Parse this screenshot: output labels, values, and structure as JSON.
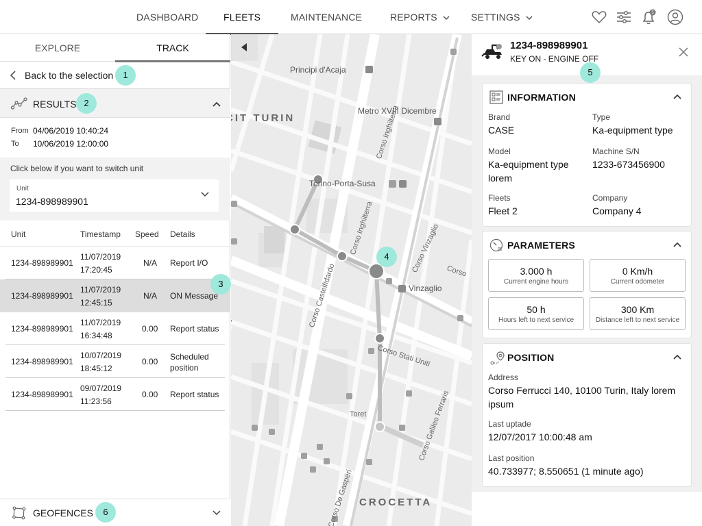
{
  "nav": {
    "items": [
      {
        "label": "DASHBOARD"
      },
      {
        "label": "FLEETS"
      },
      {
        "label": "MAINTENANCE"
      },
      {
        "label": "REPORTS"
      },
      {
        "label": "SETTINGS"
      }
    ],
    "notification_count": "5",
    "icons": [
      "heart-icon",
      "sliders-icon",
      "bell-icon",
      "user-icon"
    ]
  },
  "left": {
    "tabs": [
      {
        "label": "EXPLORE"
      },
      {
        "label": "TRACK"
      }
    ],
    "back_label": "Back to the selection",
    "results_label": "RESULTS",
    "from_label": "From",
    "from_value": "04/06/2019 10:40:24",
    "to_label": "To",
    "to_value": "10/06/2019 12:00:00",
    "switch_hint": "Click below if you want to switch unit",
    "unit_field_label": "Unit",
    "unit_field_value": "1234-898989901",
    "columns": [
      "Unit",
      "Timestamp",
      "Speed",
      "Details"
    ],
    "rows": [
      {
        "unit": "1234-898989901",
        "date": "11/07/2019",
        "time": "17:20:45",
        "speed": "N/A",
        "details": "Report I/O"
      },
      {
        "unit": "1234-898989901",
        "date": "11/07/2019",
        "time": "12:45:15",
        "speed": "N/A",
        "details": "ON Message"
      },
      {
        "unit": "1234-898989901",
        "date": "11/07/2019",
        "time": "16:34:48",
        "speed": "0.00",
        "details": "Report status"
      },
      {
        "unit": "1234-898989901",
        "date": "10/07/2019",
        "time": "18:45:12",
        "speed": "0.00",
        "details_1": "Scheduled",
        "details_2": "position"
      },
      {
        "unit": "1234-898989901",
        "date": "09/07/2019",
        "time": "11:23:56",
        "speed": "0.00",
        "details": "Report status"
      }
    ],
    "geofences_label": "GEOFENCES"
  },
  "badges": [
    "1",
    "2",
    "3",
    "4",
    "5",
    "6"
  ],
  "map": {
    "labels": {
      "principi": "Principi d'Acaja",
      "cit_turin": "CIT TURIN",
      "metro": "Metro XVIII Dicembre",
      "porta_susa": "Torino-Porta-Susa",
      "corso_inghilterra_1": "Corso Inghilterra",
      "corso_inghilterra_2": "Corso Inghilterra",
      "corso_vinzaglio": "Corso Vinzaglio",
      "corso_castelfidardo": "Corso Castelfidardo",
      "vinzaglio": "Vinzaglio",
      "corso_stati_uniti": "Corso Stati Uniti",
      "corso_galileo": "Corso Galileo Ferraris",
      "toret": "Toret",
      "crocetta": "CROCETTA",
      "de_gasperi": "Corso De Gasperi",
      "corso_co": "Corso"
    }
  },
  "right": {
    "title": "1234-898989901",
    "subtitle": "KEY ON - ENGINE OFF",
    "information": {
      "header": "INFORMATION",
      "brand_label": "Brand",
      "brand_value": "CASE",
      "type_label": "Type",
      "type_value": "Ka-equipment type",
      "model_label": "Model",
      "model_value_1": "Ka-equipment type",
      "model_value_2": "lorem",
      "sn_label": "Machine S/N",
      "sn_value": "1233-673456900",
      "fleets_label": "Fleets",
      "fleets_value": "Fleet 2",
      "company_label": "Company",
      "company_value": "Company 4"
    },
    "parameters": {
      "header": "PARAMETERS",
      "boxes": [
        {
          "value": "3.000 h",
          "label": "Current engine hours"
        },
        {
          "value": "0 Km/h",
          "label": "Current odometer"
        },
        {
          "value": "50 h",
          "label": "Hours left to next service"
        },
        {
          "value": "300 Km",
          "label": "Distance left to next service"
        }
      ]
    },
    "position": {
      "header": "POSITION",
      "address_label": "Address",
      "address_value_1": "Corso Ferrucci 140, 10100 Turin, Italy lorem",
      "address_value_2": "ipsum",
      "update_label": "Last uptade",
      "update_value": "12/07/2017 10:00:48 am",
      "last_pos_label": "Last position",
      "last_pos_value": "40.733977; 8.550651 (1 minute ago)"
    }
  }
}
